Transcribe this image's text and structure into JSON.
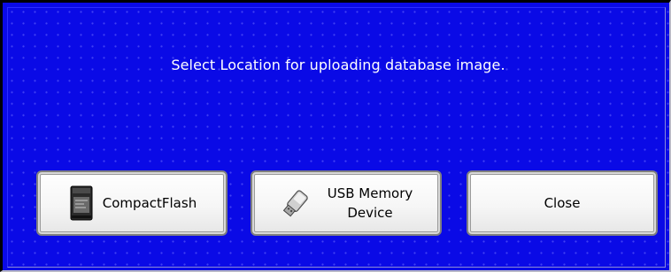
{
  "dialog": {
    "message": "Select Location for uploading database image."
  },
  "buttons": {
    "compactflash": {
      "label": "CompactFlash",
      "icon": "compactflash-card-icon"
    },
    "usb": {
      "label": "USB Memory\nDevice",
      "icon": "usb-drive-icon"
    },
    "close": {
      "label": "Close"
    }
  },
  "colors": {
    "background": "#0a0ae6",
    "text": "#ffffff",
    "button_face": "#f4f4f4"
  }
}
